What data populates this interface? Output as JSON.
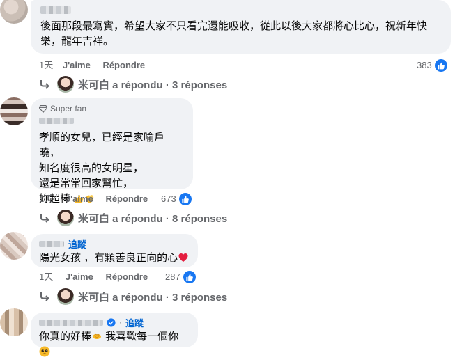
{
  "comments": [
    {
      "text": "後面那段最寫實，希望大家不只看完還能吸收，從此以後大家都將心比心，祝新年快樂，龍年吉祥。",
      "time": "1天",
      "like": "J'aime",
      "reply": "Répondre",
      "reactions": "383",
      "replies_label": "米可白 a répondu · 3 réponses"
    },
    {
      "badge": "Super fan",
      "text": "孝順的女兒，已經是家喻戶曉，\n知名度很高的女明星，\n還是常常回家幫忙，\n妳超棒",
      "time": "1天",
      "like": "J'aime",
      "reply": "Répondre",
      "reactions": "673",
      "replies_label": "米可白 a répondu · 8 réponses"
    },
    {
      "follow": "追蹤",
      "text": "陽光女孩 ，有顆善良正向的心",
      "time": "1天",
      "like": "J'aime",
      "reply": "Répondre",
      "reactions": "287",
      "replies_label": "米可白 a répondu · 3 réponses"
    },
    {
      "follow": "追蹤",
      "text_a": "你真的好棒",
      "text_b": " 我喜歡每一個你"
    }
  ],
  "colors": {
    "bubble": "#f0f2f5",
    "like_blue": "#1877f2",
    "follow_blue": "#0064d1",
    "muted": "#65676b"
  }
}
